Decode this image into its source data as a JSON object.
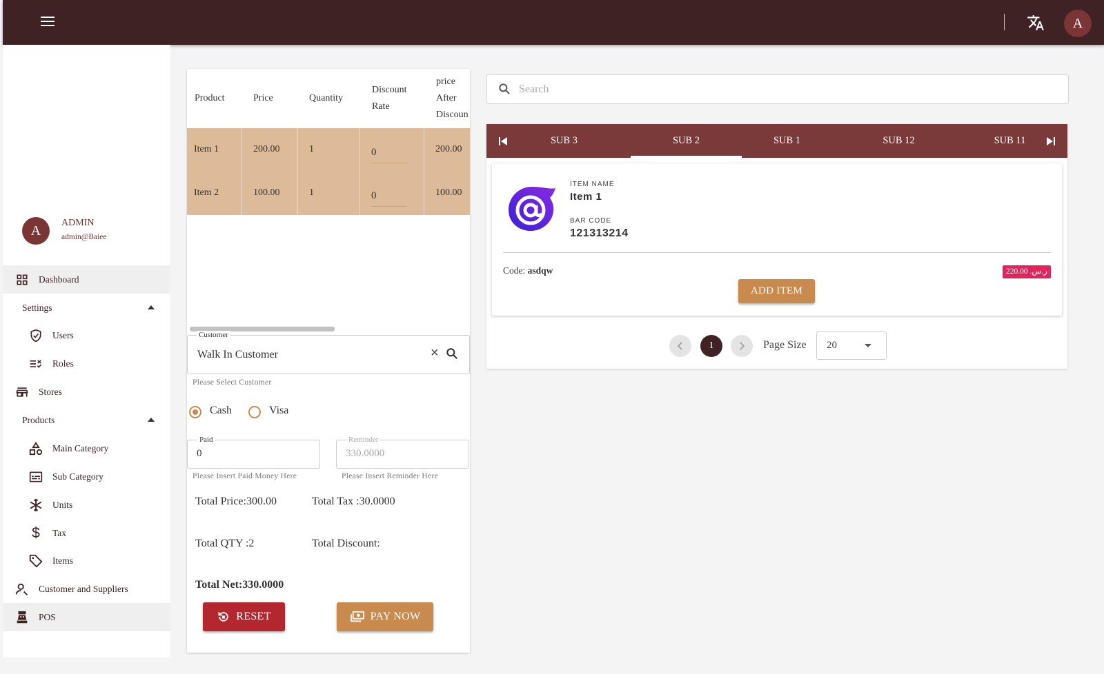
{
  "profile": {
    "avatar_letter": "A",
    "name": "ADMIN",
    "email": "admin@Baiee"
  },
  "sidebar": {
    "dashboard": "Dashboard",
    "settings": "Settings",
    "users": "Users",
    "roles": "Roles",
    "stores": "Stores",
    "products": "Products",
    "main_category": "Main Category",
    "sub_category": "Sub Category",
    "units": "Units",
    "tax": "Tax",
    "items": "Items",
    "customers": "Customer and Suppliers",
    "pos": "POS"
  },
  "cart": {
    "headers": {
      "product": "Product",
      "price": "Price",
      "quantity": "Quantity",
      "discount_1": "Discount",
      "discount_2": "Rate",
      "after_1": "price",
      "after_2": "After",
      "after_3": "Discoun"
    },
    "rows": [
      {
        "product": "Item 1",
        "price": "200.00",
        "qty": "1",
        "discount": "0",
        "after": "200.00"
      },
      {
        "product": "Item 2",
        "price": "100.00",
        "qty": "1",
        "discount": "0",
        "after": "100.00"
      }
    ]
  },
  "customer": {
    "label": "Customer",
    "value": "Walk In Customer",
    "hint": "Please Select Customer"
  },
  "payment": {
    "cash": "Cash",
    "visa": "Visa",
    "selected": "cash"
  },
  "paid": {
    "label": "Paid",
    "value": "0",
    "hint": "Please Insert Paid Money Here"
  },
  "reminder": {
    "label": "Reminder",
    "placeholder": "330.0000",
    "hint": "Please Insert Reminder Here"
  },
  "totals": {
    "price": "Total Price:300.00",
    "tax": "Total Tax :30.0000",
    "qty": "Total QTY :2",
    "discount": "Total Discount:",
    "net": "Total Net:330.0000"
  },
  "buttons": {
    "reset": "RESET",
    "pay": "PAY NOW"
  },
  "search": {
    "placeholder": "Search"
  },
  "tabs": [
    "SUB 3",
    "SUB 2",
    "SUB 1",
    "SUB 12",
    "SUB 11"
  ],
  "active_tab": "SUB 2",
  "item": {
    "name_caption": "ITEM NAME",
    "name": "Item 1",
    "barcode_caption": "BAR CODE",
    "barcode": "121313214",
    "code_label": "Code:",
    "code": "asdqw",
    "price": "220.00 .ر.س",
    "add_label": "ADD ITEM",
    "logo_icon": "blazor-logo-icon"
  },
  "pagination": {
    "current": "1",
    "page_size_label": "Page Size",
    "page_size": "20"
  },
  "colors": {
    "topbar": "#3e2224",
    "tabbar": "#7a3a3a",
    "row": "#ddbb98",
    "accent": "#c98a4d",
    "reset": "#b3282e",
    "badge": "#e0245e"
  }
}
